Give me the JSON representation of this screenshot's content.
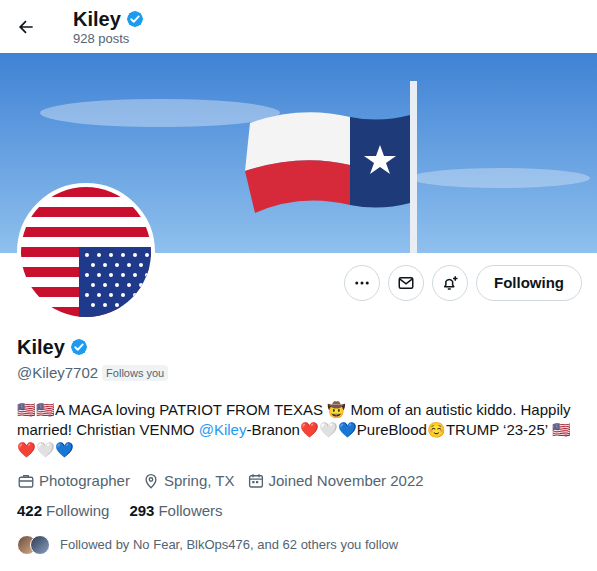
{
  "header": {
    "title": "Kiley",
    "verified": true,
    "posts": "928 posts"
  },
  "profile": {
    "name": "Kiley",
    "verified": true,
    "handle": "@Kiley7702",
    "follows_you": "Follows you"
  },
  "actions": {
    "follow_button": "Following"
  },
  "bio": [
    {
      "kind": "text",
      "text": "🇺🇸🇺🇸A MAGA loving PATRIOT FROM TEXAS 🤠 Mom of an autistic kiddo. Happily married! Christian VENMO "
    },
    {
      "kind": "link",
      "text": "@Kiley"
    },
    {
      "kind": "text",
      "text": "-Branon❤️🤍💙PureBlood☺️TRUMP ‘23-25’ 🇺🇸❤️🤍💙"
    }
  ],
  "meta": [
    {
      "kind": "job",
      "text": "Photographer"
    },
    {
      "kind": "location",
      "text": "Spring, TX"
    },
    {
      "kind": "joined",
      "text": "Joined November 2022"
    }
  ],
  "stats": [
    {
      "count": "422",
      "label": "Following"
    },
    {
      "count": "293",
      "label": "Followers"
    }
  ],
  "followed_by": "Followed by No Fear, BlkOps476, and 62 others you follow"
}
